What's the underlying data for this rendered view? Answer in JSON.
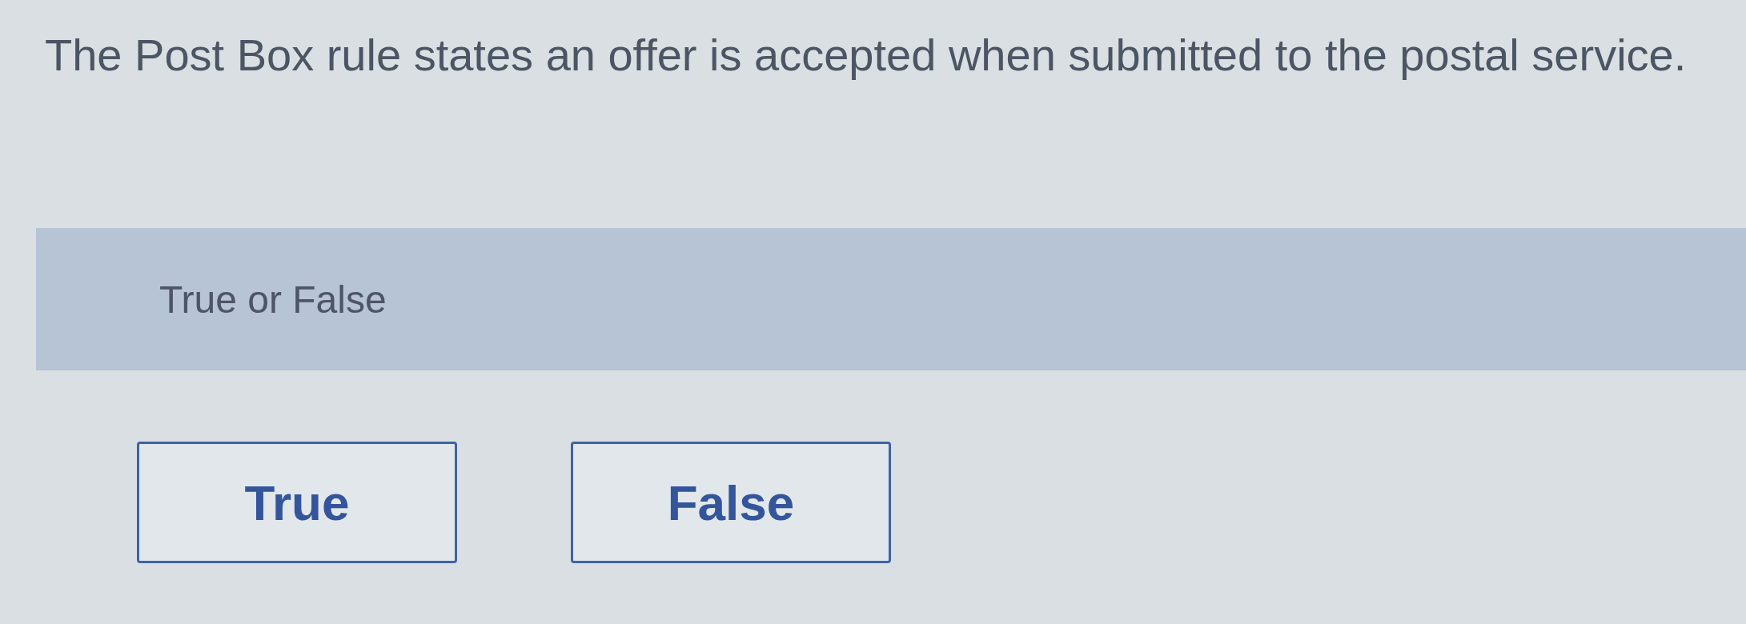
{
  "question": {
    "text": "The Post Box rule states an offer is accepted when submitted to the postal service."
  },
  "prompt_band": {
    "label": "True or False"
  },
  "options": [
    {
      "label": "True",
      "selected": false
    },
    {
      "label": "False",
      "selected": false
    }
  ]
}
